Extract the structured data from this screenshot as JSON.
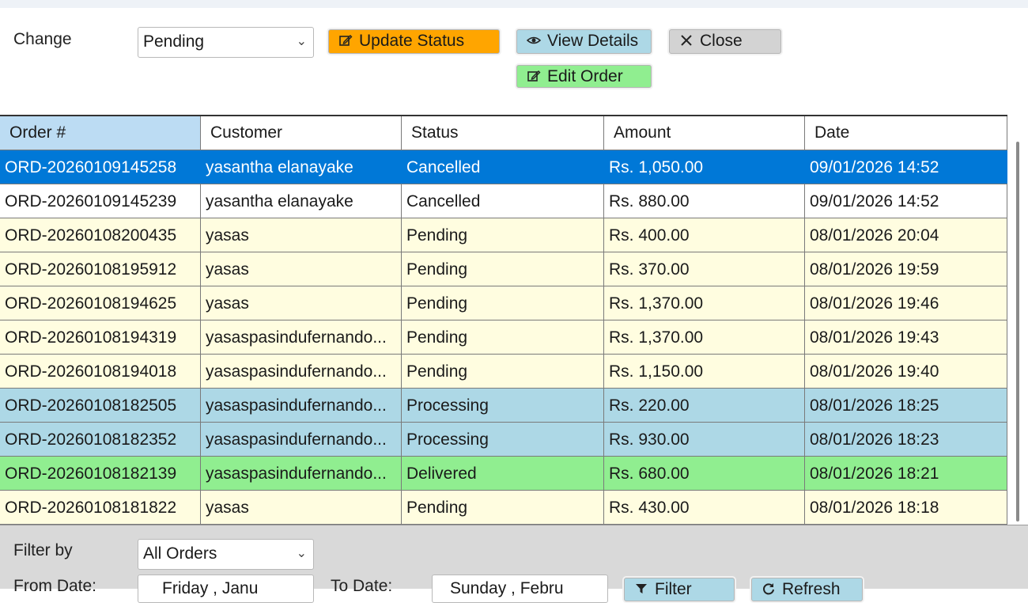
{
  "top": {
    "change_label": "Change",
    "status_select_value": "Pending",
    "buttons": {
      "update_status": "Update Status",
      "view_details": "View Details",
      "close": "Close",
      "edit_order": "Edit Order"
    }
  },
  "grid": {
    "columns": [
      "Order #",
      "Customer",
      "Status",
      "Amount",
      "Date"
    ],
    "rows": [
      {
        "order": "ORD-20260109145258",
        "customer": "yasantha elanayake",
        "status": "Cancelled",
        "amount": "Rs. 1,050.00",
        "date": "09/01/2026 14:52",
        "style": "sel"
      },
      {
        "order": "ORD-20260109145239",
        "customer": "yasantha elanayake",
        "status": "Cancelled",
        "amount": "Rs. 880.00",
        "date": "09/01/2026 14:52",
        "style": "white"
      },
      {
        "order": "ORD-20260108200435",
        "customer": "yasas",
        "status": "Pending",
        "amount": "Rs. 400.00",
        "date": "08/01/2026 20:04",
        "style": "yellow"
      },
      {
        "order": "ORD-20260108195912",
        "customer": "yasas",
        "status": "Pending",
        "amount": "Rs. 370.00",
        "date": "08/01/2026 19:59",
        "style": "yellow"
      },
      {
        "order": "ORD-20260108194625",
        "customer": "yasas",
        "status": "Pending",
        "amount": "Rs. 1,370.00",
        "date": "08/01/2026 19:46",
        "style": "yellow"
      },
      {
        "order": "ORD-20260108194319",
        "customer": "yasaspasindufernando...",
        "status": "Pending",
        "amount": "Rs. 1,370.00",
        "date": "08/01/2026 19:43",
        "style": "yellow"
      },
      {
        "order": "ORD-20260108194018",
        "customer": "yasaspasindufernando...",
        "status": "Pending",
        "amount": "Rs. 1,150.00",
        "date": "08/01/2026 19:40",
        "style": "yellow"
      },
      {
        "order": "ORD-20260108182505",
        "customer": "yasaspasindufernando...",
        "status": "Processing",
        "amount": "Rs. 220.00",
        "date": "08/01/2026 18:25",
        "style": "blue"
      },
      {
        "order": "ORD-20260108182352",
        "customer": "yasaspasindufernando...",
        "status": "Processing",
        "amount": "Rs. 930.00",
        "date": "08/01/2026 18:23",
        "style": "blue"
      },
      {
        "order": "ORD-20260108182139",
        "customer": "yasaspasindufernando...",
        "status": "Delivered",
        "amount": "Rs. 680.00",
        "date": "08/01/2026 18:21",
        "style": "green"
      },
      {
        "order": "ORD-20260108181822",
        "customer": "yasas",
        "status": "Pending",
        "amount": "Rs. 430.00",
        "date": "08/01/2026 18:18",
        "style": "yellow"
      }
    ]
  },
  "filter": {
    "filter_by_label": "Filter by",
    "filter_select_value": "All Orders",
    "from_date_label": "From Date:",
    "from_date_value": "Friday    ,   Janu",
    "to_date_label": "To Date:",
    "to_date_value": "Sunday    ,   Febru",
    "filter_button": "Filter",
    "refresh_button": "Refresh"
  },
  "colors": {
    "update_status": "#ffa500",
    "view_details": "#add8e6",
    "close": "#d3d3d3",
    "edit_order": "#90ee90",
    "selected_row": "#0078d7",
    "pending_row": "#fffde0",
    "processing_row": "#add8e6",
    "delivered_row": "#90ee90"
  },
  "icons": {
    "update_status": "edit-icon",
    "view_details": "eye-icon",
    "close": "close-icon",
    "edit_order": "edit-icon",
    "filter": "funnel-icon",
    "refresh": "refresh-icon"
  }
}
